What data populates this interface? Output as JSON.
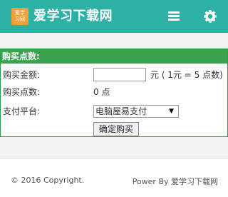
{
  "header": {
    "logo_text": "爱学习网",
    "site_title": "爱学习下载网",
    "menu_icon": "hamburger-menu-icon",
    "settings_icon": "gear-icon"
  },
  "panel": {
    "heading": "购买点数:",
    "amount_label": "购买金额:",
    "amount_value": "",
    "amount_unit": "元 ( 1元 = 5 点数)",
    "points_label": "购买点数:",
    "points_value": "0 点",
    "platform_label": "支付平台:",
    "platform_selected": "电脑屋易支付",
    "submit_label": "确定购买"
  },
  "footer": {
    "copyright": "© 2016 Copyright.",
    "powered_by": "Power By 爱学习下载网"
  },
  "colors": {
    "header_bg": "#2db1a6",
    "panel_border": "#2e9e46",
    "panel_heading_bg": "#3aa24c",
    "logo_bg": "#f0a23a"
  }
}
